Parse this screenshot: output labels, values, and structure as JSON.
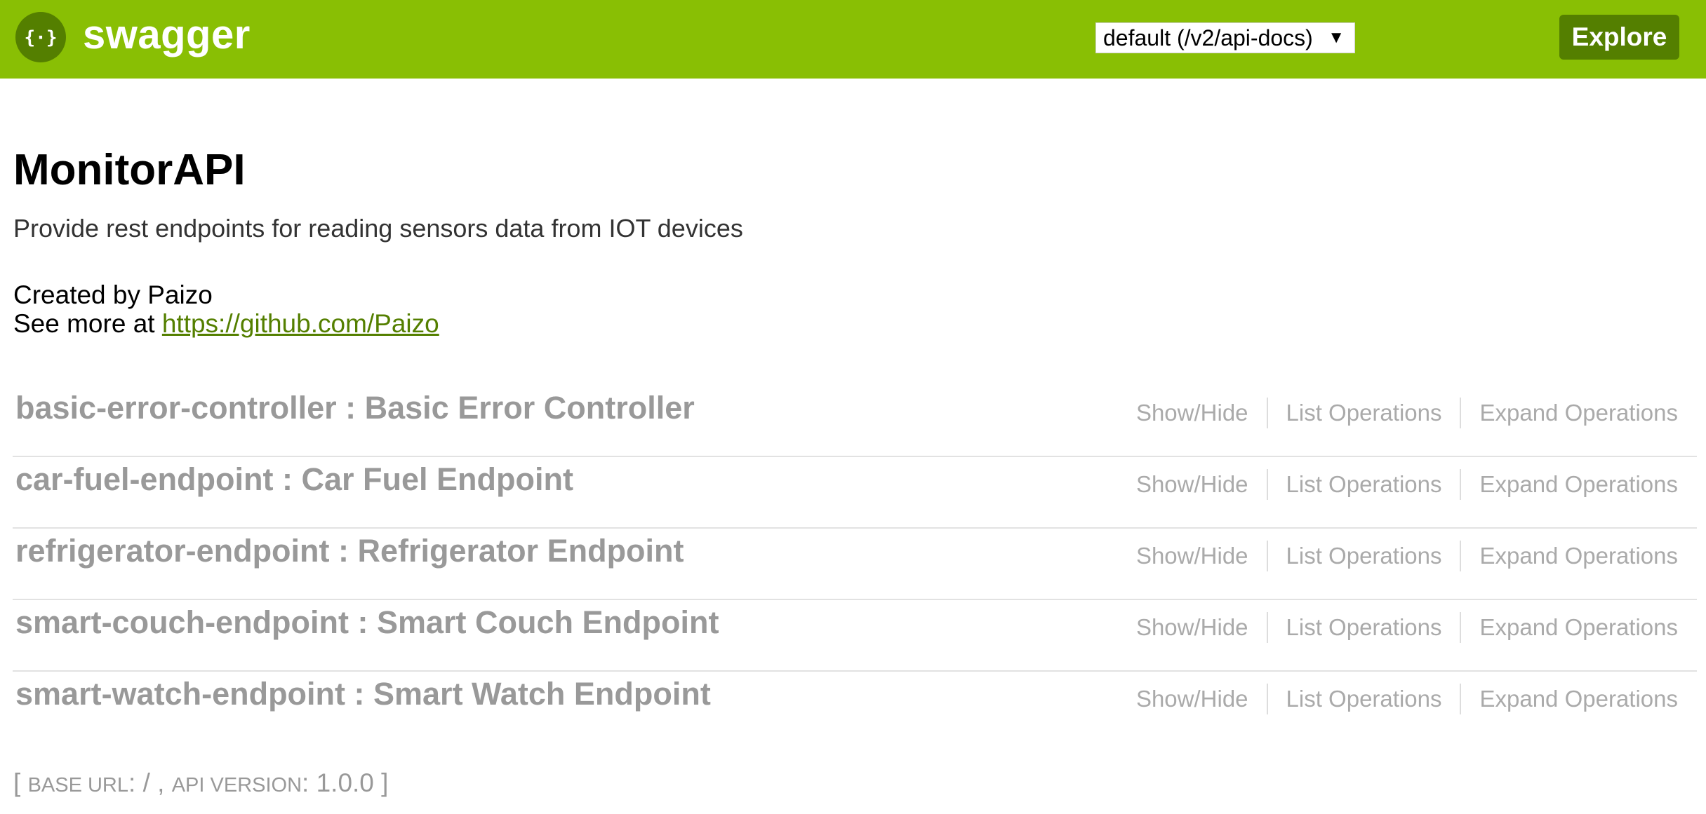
{
  "header": {
    "logo_icon": "swagger-braces-icon",
    "logo_text": "swagger",
    "api_select_value": "default (/v2/api-docs)",
    "explore_label": "Explore",
    "brand_color": "#89bf04",
    "dark_color": "#547f00"
  },
  "info": {
    "title": "MonitorAPI",
    "description": "Provide rest endpoints for reading sensors data from IOT devices",
    "created_by": "Created by Paizo",
    "see_more_prefix": "See more at ",
    "see_more_link": "https://github.com/Paizo"
  },
  "resources": [
    {
      "heading": "basic-error-controller : Basic Error Controller",
      "show_hide": "Show/Hide",
      "list_ops": "List Operations",
      "expand_ops": "Expand Operations"
    },
    {
      "heading": "car-fuel-endpoint : Car Fuel Endpoint",
      "show_hide": "Show/Hide",
      "list_ops": "List Operations",
      "expand_ops": "Expand Operations"
    },
    {
      "heading": "refrigerator-endpoint : Refrigerator Endpoint",
      "show_hide": "Show/Hide",
      "list_ops": "List Operations",
      "expand_ops": "Expand Operations"
    },
    {
      "heading": "smart-couch-endpoint : Smart Couch Endpoint",
      "show_hide": "Show/Hide",
      "list_ops": "List Operations",
      "expand_ops": "Expand Operations"
    },
    {
      "heading": "smart-watch-endpoint : Smart Watch Endpoint",
      "show_hide": "Show/Hide",
      "list_ops": "List Operations",
      "expand_ops": "Expand Operations"
    }
  ],
  "footer": {
    "open": "[ ",
    "base_url_label": "Base URL",
    "base_url_value": ": / , ",
    "api_version_label": "Api Version",
    "api_version_value": ": 1.0.0 ",
    "close": "]"
  }
}
